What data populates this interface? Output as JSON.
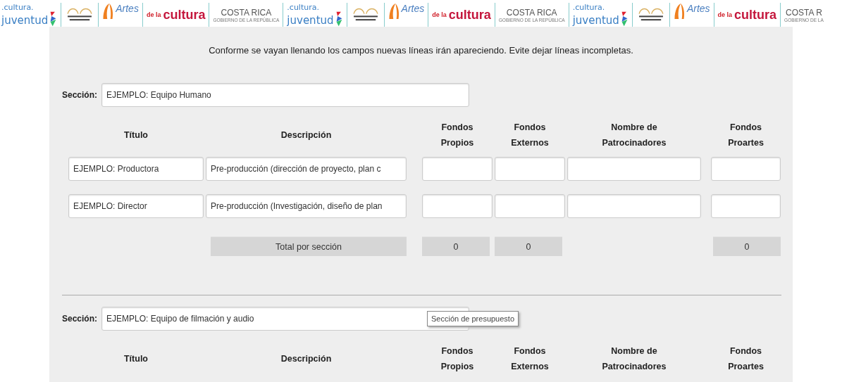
{
  "banner": {
    "logos": [
      {
        "kind": "juventud",
        "top": ".cultura.",
        "main": "juventud"
      },
      {
        "kind": "teatro"
      },
      {
        "kind": "artes",
        "main": "Artes"
      },
      {
        "kind": "cultura",
        "top": "de la",
        "main": "cultura"
      },
      {
        "kind": "costarica",
        "main": "COSTA RICA",
        "sub": "GOBIERNO DE LA REPÚBLICA"
      },
      {
        "kind": "juventud",
        "top": ".cultura.",
        "main": "juventud"
      },
      {
        "kind": "teatro"
      },
      {
        "kind": "artes",
        "main": "Artes"
      },
      {
        "kind": "cultura",
        "top": "de la",
        "main": "cultura"
      },
      {
        "kind": "costarica",
        "main": "COSTA RICA",
        "sub": "GOBIERNO DE LA REPÚBLICA"
      },
      {
        "kind": "juventud",
        "top": ".cultura.",
        "main": "juventud"
      },
      {
        "kind": "teatro"
      },
      {
        "kind": "artes",
        "main": "Artes"
      },
      {
        "kind": "cultura",
        "top": "de la",
        "main": "cultura"
      },
      {
        "kind": "costarica",
        "main": "COSTA R",
        "sub": "GOBIERNO DE LA"
      }
    ]
  },
  "notice": "Conforme se vayan llenando los campos nuevas líneas irán apareciendo. Evite dejar líneas incompletas.",
  "sections": [
    {
      "label": "Sección:",
      "name": "EJEMPLO: Equipo Humano",
      "columns": [
        "Título",
        "Descripción",
        "Fondos Propios",
        "Fondos Externos",
        "Nombre de Patrocinadores",
        "Fondos Proartes"
      ],
      "rows": [
        {
          "titulo": "EJEMPLO: Productora",
          "descripcion": "Pre-producción (dirección de proyecto, plan c"
        },
        {
          "titulo": "EJEMPLO: Director",
          "descripcion": "Pre-producción (Investigación, diseño de plan"
        }
      ],
      "total": {
        "label": "Total por sección",
        "fondos_propios": "0",
        "fondos_externos": "0",
        "fondos_proartes": "0"
      }
    },
    {
      "label": "Sección:",
      "name": "EJEMPLO: Equipo de filmación y audio",
      "tooltip": "Sección de presupuesto",
      "columns": [
        "Título",
        "Descripción",
        "Fondos Propios",
        "Fondos Externos",
        "Nombre de Patrocinadores",
        "Fondos Proartes"
      ]
    }
  ]
}
